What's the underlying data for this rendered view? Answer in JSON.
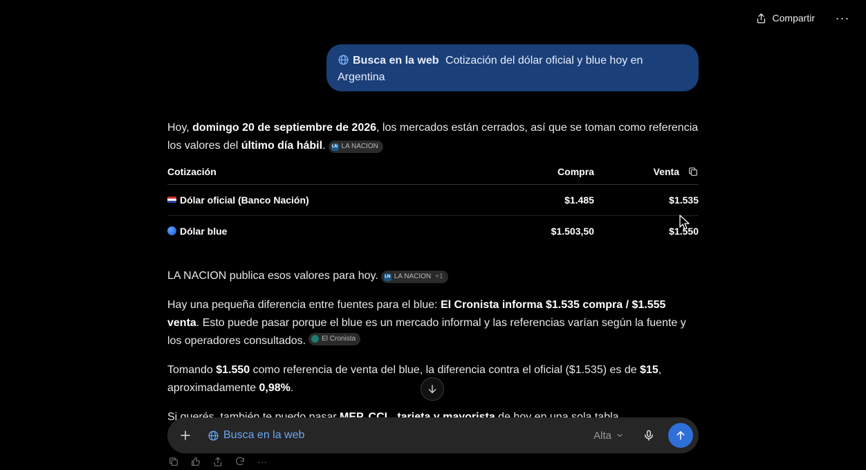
{
  "header": {
    "share_label": "Compartir",
    "more_label": "···"
  },
  "user_message": {
    "tool_label": "Busca en la web",
    "text": "Cotización del dólar oficial y blue hoy en Argentina"
  },
  "answer": {
    "intro": {
      "p1": "Hoy, ",
      "date": "domingo 20 de septiembre de 2026",
      "p2": ", los mercados están cerrados, así que se toman como referencia los valores del ",
      "bold2": "último día hábil",
      "p3": ".",
      "source": "LA NACION"
    },
    "table": {
      "headers": [
        "Cotización",
        "Compra",
        "Venta"
      ],
      "rows": [
        {
          "name": "Dólar oficial (Banco Nación)",
          "compra": "$1.485",
          "venta": "$1.535",
          "icon": "flag-usa"
        },
        {
          "name": "Dólar blue",
          "compra": "$1.503,50",
          "venta": "$1.550",
          "icon": "blue-circle"
        }
      ]
    },
    "para2": {
      "text": "LA NACION publica esos valores para hoy.",
      "source": "LA NACION",
      "extra": "+1"
    },
    "para3": {
      "t1": "Hay una pequeña diferencia entre fuentes para el blue: ",
      "b1": "El Cronista informa $1.535 compra / $1.555 venta",
      "t2": ". Esto puede pasar porque el blue es un mercado informal y las referencias varían según la fuente y los operadores consultados.",
      "source": "El Cronista"
    },
    "para4": {
      "t1": "Tomando ",
      "b1": "$1.550",
      "t2": " como referencia de venta del blue, la diferencia contra el oficial ($1.535) es de ",
      "b2": "$15",
      "t3": ", aproximadamente ",
      "b3": "0,98%",
      "t4": "."
    },
    "para5": {
      "t1": "Si querés, también te puedo pasar ",
      "b1": "MEP, CCL, tarjeta y mayorista",
      "t2": " de hoy en una sola tabla."
    }
  },
  "composer": {
    "tool_label": "Busca en la web",
    "model_label": "Alta"
  },
  "colors": {
    "user_bubble": "#1b3f78",
    "send_button": "#2f6fd8",
    "tool_blue": "#6aa7f5"
  }
}
